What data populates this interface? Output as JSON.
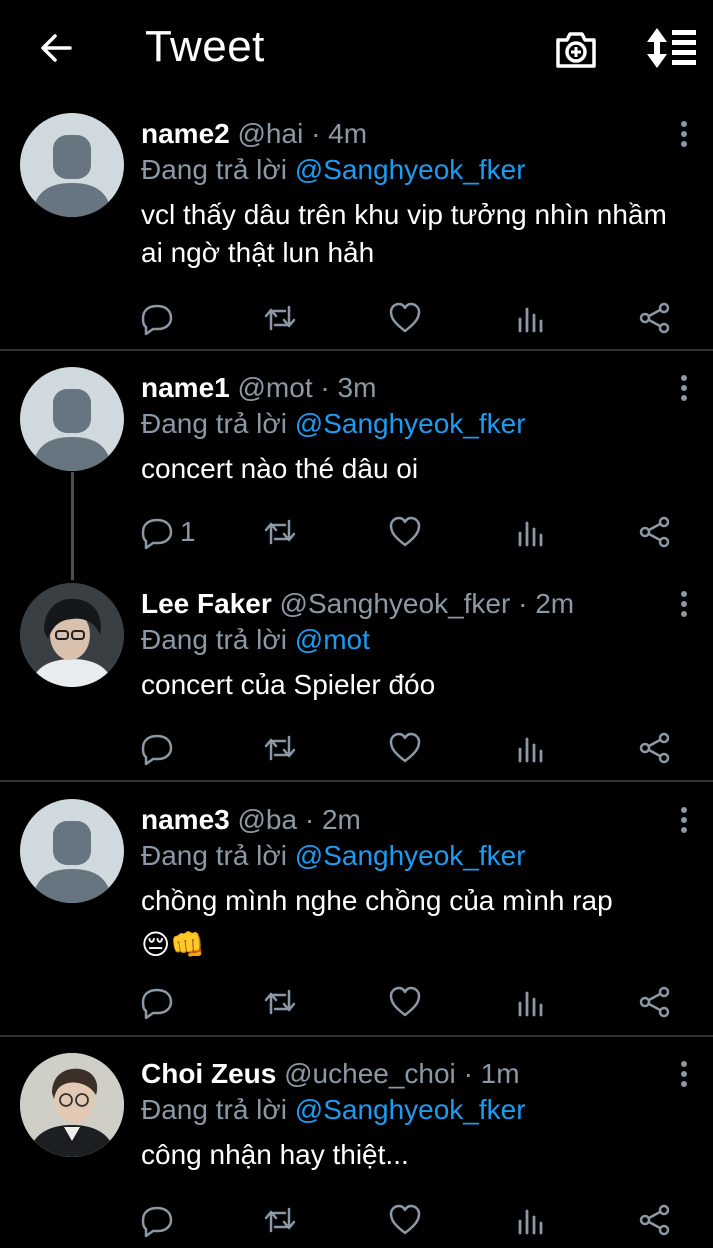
{
  "header": {
    "title": "Tweet"
  },
  "reply_prefix": "Đang trả lời",
  "tweets": [
    {
      "name": "name2",
      "handle": "@hai",
      "time": "· 4m",
      "reply_to": "@Sanghyeok_fker",
      "text": "vcl thấy dâu trên khu vip tưởng nhìn nhầm ai ngờ thật lun hảh",
      "reply_count": ""
    },
    {
      "name": "name1",
      "handle": "@mot",
      "time": "· 3m",
      "reply_to": "@Sanghyeok_fker",
      "text": "concert nào thé dâu oi",
      "reply_count": "1"
    },
    {
      "name": "Lee Faker",
      "handle": "@Sanghyeok_fker",
      "time": "· 2m",
      "reply_to": "@mot",
      "text": "concert của Spieler đóo",
      "reply_count": ""
    },
    {
      "name": "name3",
      "handle": "@ba",
      "time": "· 2m",
      "reply_to": "@Sanghyeok_fker",
      "text": "chồng mình nghe chồng của mình rap",
      "emoji": "😔👊",
      "reply_count": ""
    },
    {
      "name": "Choi Zeus",
      "handle": "@uchee_choi",
      "time": "· 1m",
      "reply_to": "@Sanghyeok_fker",
      "text": "công nhận hay thiệt...",
      "reply_count": ""
    }
  ],
  "colors": {
    "background": "#000000",
    "accent": "#1d9bf0",
    "muted": "#8b98a5",
    "divider": "#2f3336"
  },
  "icons": [
    "back-arrow-icon",
    "camera-plus-icon",
    "sort-icon",
    "reply-icon",
    "retweet-icon",
    "like-icon",
    "views-icon",
    "share-icon",
    "more-vertical-icon"
  ]
}
